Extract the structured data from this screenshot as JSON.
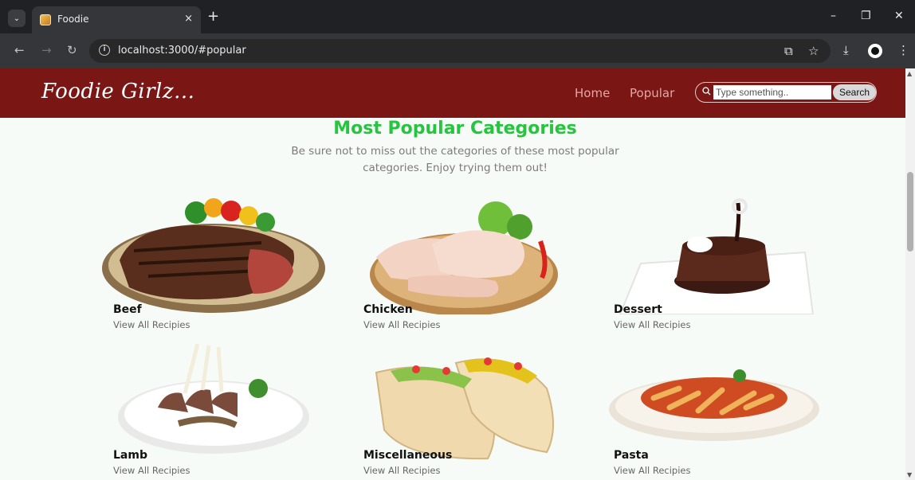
{
  "browser": {
    "tab_title": "Foodie",
    "tab_close": "×",
    "new_tab": "+",
    "url": "localhost:3000/#popular",
    "minimize": "–",
    "restore": "❐",
    "close": "✕"
  },
  "navbar": {
    "brand": "Foodie Girlz...",
    "links": [
      "Home",
      "Popular"
    ],
    "search_placeholder": "Type something..",
    "search_button": "Search"
  },
  "section": {
    "title": "Most Popular Categories",
    "description": "Be sure not to miss out the categories of these most popular categories. Enjoy trying them out!"
  },
  "categories": [
    {
      "name": "Beef",
      "link": "View All Recipies",
      "icon": "steak-image"
    },
    {
      "name": "Chicken",
      "link": "View All Recipies",
      "icon": "chicken-image"
    },
    {
      "name": "Dessert",
      "link": "View All Recipies",
      "icon": "dessert-image"
    },
    {
      "name": "Lamb",
      "link": "View All Recipies",
      "icon": "lamb-image"
    },
    {
      "name": "Miscellaneous",
      "link": "View All Recipies",
      "icon": "taco-image"
    },
    {
      "name": "Pasta",
      "link": "View All Recipies",
      "icon": "pasta-image"
    }
  ],
  "colors": {
    "navbar": "#7a1614",
    "title": "#27c43f"
  }
}
